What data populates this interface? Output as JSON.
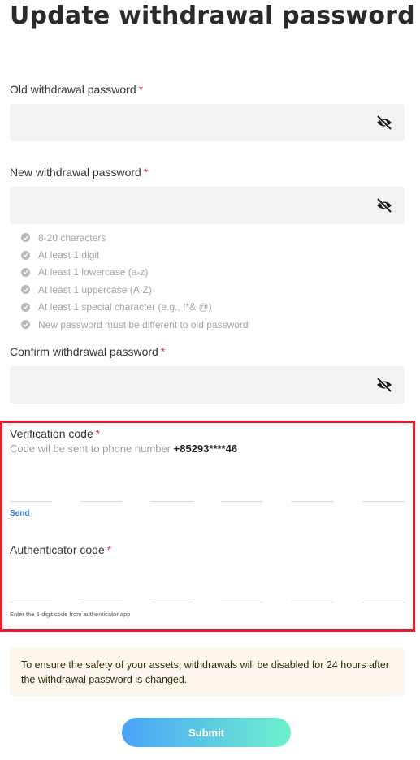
{
  "page": {
    "title": "Update withdrawal password"
  },
  "required_mark": "*",
  "old_password": {
    "label": "Old withdrawal password",
    "value": ""
  },
  "new_password": {
    "label": "New withdrawal password",
    "value": "",
    "rules": [
      "8-20 characters",
      "At least 1 digit",
      "At least 1 lowercase (a-z)",
      "At least 1 uppercase (A-Z)",
      "At least 1 special character (e.g., !*& @)",
      "New password must be different to old password"
    ]
  },
  "confirm_password": {
    "label": "Confirm withdrawal password",
    "value": ""
  },
  "verification": {
    "label": "Verification code",
    "hint_prefix": "Code wil be sent to phone number",
    "phone": "+85293****46",
    "send_label": "Send"
  },
  "authenticator": {
    "label": "Authenticator code",
    "hint": "Enter the 6-digit code from authenticator app"
  },
  "notice": "To ensure the safety of your assets, withdrawals will be disabled for 24 hours after the withdrawal password is changed.",
  "submit_label": "Submit",
  "icons": {
    "visibility_toggle": "eye-off-icon",
    "rule_status": "check-circle-icon"
  },
  "colors": {
    "required": "#e8335a",
    "highlight_border": "#e21f26",
    "link": "#2f7de8",
    "notice_bg": "#fdf6ec"
  }
}
